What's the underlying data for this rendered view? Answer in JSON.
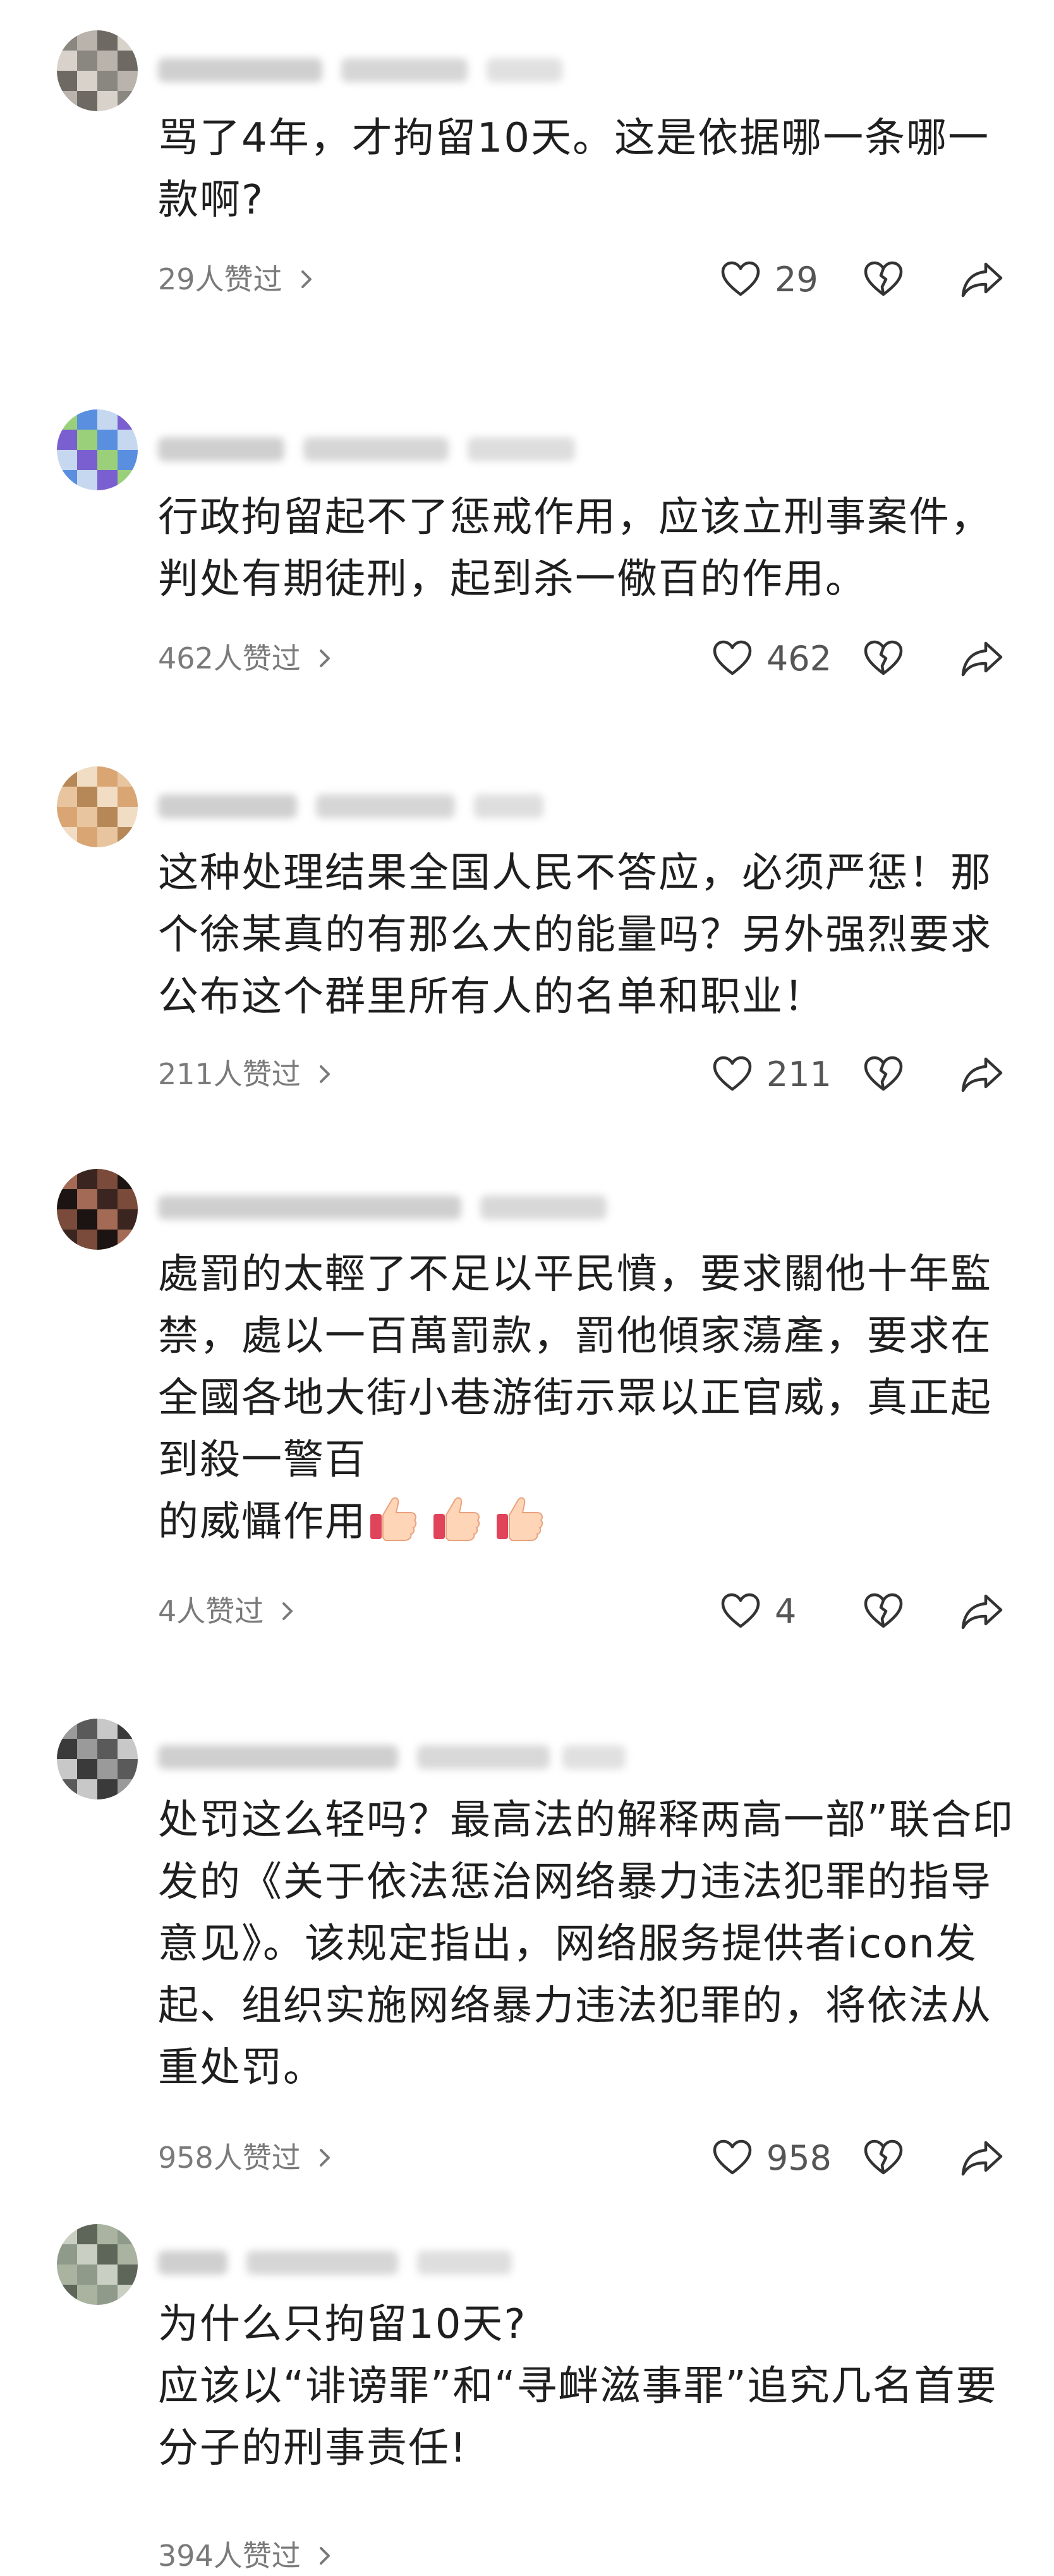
{
  "comments": [
    {
      "text": "骂了4年，才拘留10天。这是依据哪一条哪一款啊?",
      "likes_label": "29人赞过",
      "like_count": "29",
      "avatar_colors": [
        "#8a8680",
        "#b9b3ab",
        "#6e6963",
        "#d8d2cb"
      ]
    },
    {
      "text": "行政拘留起不了惩戒作用，应该立刑事案件，判处有期徒刑，起到杀一儆百的作用。",
      "likes_label": "462人赞过",
      "like_count": "462",
      "avatar_colors": [
        "#7a5fd0",
        "#9bd07a",
        "#5a8fe0",
        "#c6d8f0"
      ]
    },
    {
      "text": "这种处理结果全国人民不答应，必须严惩！那个徐某真的有那么大的能量吗？另外强烈要求公布这个群里所有人的名单和职业！",
      "likes_label": "211人赞过",
      "like_count": "211",
      "avatar_colors": [
        "#d9a673",
        "#e8c59e",
        "#b78857",
        "#f1dcc4"
      ]
    },
    {
      "text": "處罰的太輕了不足以平民憤，要求關他十年監禁，處以一百萬罰款，罰他傾家蕩產，要求在全國各地大街小巷游街示眾以正官威，真正起到殺一警百\n的威懾作用",
      "emoji_count": 3,
      "likes_label": "4人赞过",
      "like_count": "4",
      "avatar_colors": [
        "#3a2520",
        "#7a4a3a",
        "#1c1412",
        "#a36a55"
      ]
    },
    {
      "text": "处罚这么轻吗？最高法的解释两高一部”联合印发的《关于依法惩治网络暴力违法犯罪的指导意见》。该规定指出，网络服务提供者icon发起、组织实施网络暴力违法犯罪的，将依法从重处罚。",
      "likes_label": "958人赞过",
      "like_count": "958",
      "avatar_colors": [
        "#9a9a9a",
        "#5a5a5a",
        "#c8c8c8",
        "#3a3a3a"
      ]
    },
    {
      "text": "为什么只拘留10天?\n应该以“诽谤罪”和“寻衅滋事罪”追究几名首要分子的刑事责任!",
      "likes_label": "394人赞过",
      "avatar_colors": [
        "#8f9a8a",
        "#c9cfc2",
        "#5e665a",
        "#a9b3a0"
      ]
    }
  ]
}
